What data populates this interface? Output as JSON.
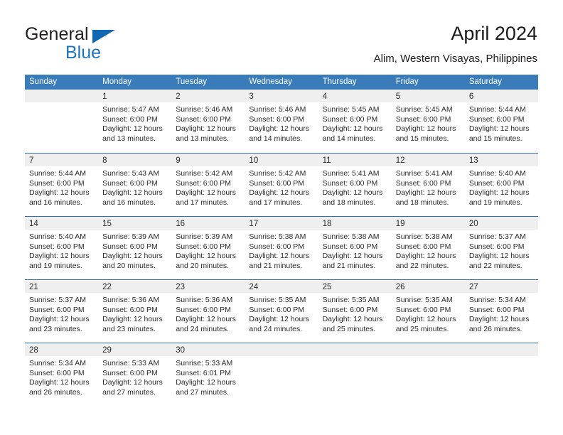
{
  "brand": {
    "name_part1": "General",
    "name_part2": "Blue",
    "triangle_color": "#1268b3",
    "blue_color": "#1b75bb"
  },
  "header": {
    "title": "April 2024",
    "subtitle": "Alim, Western Visayas, Philippines"
  },
  "theme": {
    "header_row_bg": "#3a7cba",
    "row_divider": "#2f6fae",
    "day_band_bg": "#efefef",
    "text": "#2a2a2a"
  },
  "weekdays": [
    "Sunday",
    "Monday",
    "Tuesday",
    "Wednesday",
    "Thursday",
    "Friday",
    "Saturday"
  ],
  "weeks": [
    [
      {
        "day": "",
        "sunrise": "",
        "sunset": "",
        "daylight1": "",
        "daylight2": "",
        "empty": true
      },
      {
        "day": "1",
        "sunrise": "Sunrise: 5:47 AM",
        "sunset": "Sunset: 6:00 PM",
        "daylight1": "Daylight: 12 hours",
        "daylight2": "and 13 minutes."
      },
      {
        "day": "2",
        "sunrise": "Sunrise: 5:46 AM",
        "sunset": "Sunset: 6:00 PM",
        "daylight1": "Daylight: 12 hours",
        "daylight2": "and 13 minutes."
      },
      {
        "day": "3",
        "sunrise": "Sunrise: 5:46 AM",
        "sunset": "Sunset: 6:00 PM",
        "daylight1": "Daylight: 12 hours",
        "daylight2": "and 14 minutes."
      },
      {
        "day": "4",
        "sunrise": "Sunrise: 5:45 AM",
        "sunset": "Sunset: 6:00 PM",
        "daylight1": "Daylight: 12 hours",
        "daylight2": "and 14 minutes."
      },
      {
        "day": "5",
        "sunrise": "Sunrise: 5:45 AM",
        "sunset": "Sunset: 6:00 PM",
        "daylight1": "Daylight: 12 hours",
        "daylight2": "and 15 minutes."
      },
      {
        "day": "6",
        "sunrise": "Sunrise: 5:44 AM",
        "sunset": "Sunset: 6:00 PM",
        "daylight1": "Daylight: 12 hours",
        "daylight2": "and 15 minutes."
      }
    ],
    [
      {
        "day": "7",
        "sunrise": "Sunrise: 5:44 AM",
        "sunset": "Sunset: 6:00 PM",
        "daylight1": "Daylight: 12 hours",
        "daylight2": "and 16 minutes."
      },
      {
        "day": "8",
        "sunrise": "Sunrise: 5:43 AM",
        "sunset": "Sunset: 6:00 PM",
        "daylight1": "Daylight: 12 hours",
        "daylight2": "and 16 minutes."
      },
      {
        "day": "9",
        "sunrise": "Sunrise: 5:42 AM",
        "sunset": "Sunset: 6:00 PM",
        "daylight1": "Daylight: 12 hours",
        "daylight2": "and 17 minutes."
      },
      {
        "day": "10",
        "sunrise": "Sunrise: 5:42 AM",
        "sunset": "Sunset: 6:00 PM",
        "daylight1": "Daylight: 12 hours",
        "daylight2": "and 17 minutes."
      },
      {
        "day": "11",
        "sunrise": "Sunrise: 5:41 AM",
        "sunset": "Sunset: 6:00 PM",
        "daylight1": "Daylight: 12 hours",
        "daylight2": "and 18 minutes."
      },
      {
        "day": "12",
        "sunrise": "Sunrise: 5:41 AM",
        "sunset": "Sunset: 6:00 PM",
        "daylight1": "Daylight: 12 hours",
        "daylight2": "and 18 minutes."
      },
      {
        "day": "13",
        "sunrise": "Sunrise: 5:40 AM",
        "sunset": "Sunset: 6:00 PM",
        "daylight1": "Daylight: 12 hours",
        "daylight2": "and 19 minutes."
      }
    ],
    [
      {
        "day": "14",
        "sunrise": "Sunrise: 5:40 AM",
        "sunset": "Sunset: 6:00 PM",
        "daylight1": "Daylight: 12 hours",
        "daylight2": "and 19 minutes."
      },
      {
        "day": "15",
        "sunrise": "Sunrise: 5:39 AM",
        "sunset": "Sunset: 6:00 PM",
        "daylight1": "Daylight: 12 hours",
        "daylight2": "and 20 minutes."
      },
      {
        "day": "16",
        "sunrise": "Sunrise: 5:39 AM",
        "sunset": "Sunset: 6:00 PM",
        "daylight1": "Daylight: 12 hours",
        "daylight2": "and 20 minutes."
      },
      {
        "day": "17",
        "sunrise": "Sunrise: 5:38 AM",
        "sunset": "Sunset: 6:00 PM",
        "daylight1": "Daylight: 12 hours",
        "daylight2": "and 21 minutes."
      },
      {
        "day": "18",
        "sunrise": "Sunrise: 5:38 AM",
        "sunset": "Sunset: 6:00 PM",
        "daylight1": "Daylight: 12 hours",
        "daylight2": "and 21 minutes."
      },
      {
        "day": "19",
        "sunrise": "Sunrise: 5:38 AM",
        "sunset": "Sunset: 6:00 PM",
        "daylight1": "Daylight: 12 hours",
        "daylight2": "and 22 minutes."
      },
      {
        "day": "20",
        "sunrise": "Sunrise: 5:37 AM",
        "sunset": "Sunset: 6:00 PM",
        "daylight1": "Daylight: 12 hours",
        "daylight2": "and 22 minutes."
      }
    ],
    [
      {
        "day": "21",
        "sunrise": "Sunrise: 5:37 AM",
        "sunset": "Sunset: 6:00 PM",
        "daylight1": "Daylight: 12 hours",
        "daylight2": "and 23 minutes."
      },
      {
        "day": "22",
        "sunrise": "Sunrise: 5:36 AM",
        "sunset": "Sunset: 6:00 PM",
        "daylight1": "Daylight: 12 hours",
        "daylight2": "and 23 minutes."
      },
      {
        "day": "23",
        "sunrise": "Sunrise: 5:36 AM",
        "sunset": "Sunset: 6:00 PM",
        "daylight1": "Daylight: 12 hours",
        "daylight2": "and 24 minutes."
      },
      {
        "day": "24",
        "sunrise": "Sunrise: 5:35 AM",
        "sunset": "Sunset: 6:00 PM",
        "daylight1": "Daylight: 12 hours",
        "daylight2": "and 24 minutes."
      },
      {
        "day": "25",
        "sunrise": "Sunrise: 5:35 AM",
        "sunset": "Sunset: 6:00 PM",
        "daylight1": "Daylight: 12 hours",
        "daylight2": "and 25 minutes."
      },
      {
        "day": "26",
        "sunrise": "Sunrise: 5:35 AM",
        "sunset": "Sunset: 6:00 PM",
        "daylight1": "Daylight: 12 hours",
        "daylight2": "and 25 minutes."
      },
      {
        "day": "27",
        "sunrise": "Sunrise: 5:34 AM",
        "sunset": "Sunset: 6:00 PM",
        "daylight1": "Daylight: 12 hours",
        "daylight2": "and 26 minutes."
      }
    ],
    [
      {
        "day": "28",
        "sunrise": "Sunrise: 5:34 AM",
        "sunset": "Sunset: 6:00 PM",
        "daylight1": "Daylight: 12 hours",
        "daylight2": "and 26 minutes."
      },
      {
        "day": "29",
        "sunrise": "Sunrise: 5:33 AM",
        "sunset": "Sunset: 6:00 PM",
        "daylight1": "Daylight: 12 hours",
        "daylight2": "and 27 minutes."
      },
      {
        "day": "30",
        "sunrise": "Sunrise: 5:33 AM",
        "sunset": "Sunset: 6:01 PM",
        "daylight1": "Daylight: 12 hours",
        "daylight2": "and 27 minutes."
      },
      {
        "day": "",
        "sunrise": "",
        "sunset": "",
        "daylight1": "",
        "daylight2": "",
        "empty": true
      },
      {
        "day": "",
        "sunrise": "",
        "sunset": "",
        "daylight1": "",
        "daylight2": "",
        "empty": true
      },
      {
        "day": "",
        "sunrise": "",
        "sunset": "",
        "daylight1": "",
        "daylight2": "",
        "empty": true
      },
      {
        "day": "",
        "sunrise": "",
        "sunset": "",
        "daylight1": "",
        "daylight2": "",
        "empty": true
      }
    ]
  ]
}
